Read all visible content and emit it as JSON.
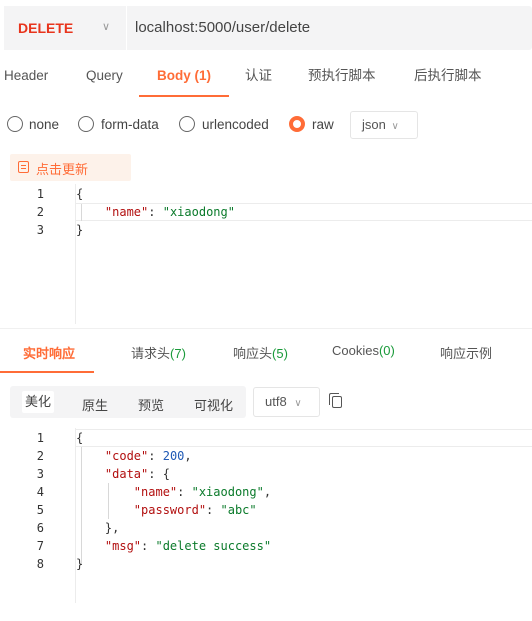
{
  "request": {
    "method": "DELETE",
    "url": "localhost:5000/user/delete"
  },
  "tabs": [
    {
      "label": "Header"
    },
    {
      "label": "Query"
    },
    {
      "label": "Body (1)"
    },
    {
      "label": "认证"
    },
    {
      "label": "预执行脚本"
    },
    {
      "label": "后执行脚本"
    }
  ],
  "body_types": {
    "options": [
      "none",
      "form-data",
      "urlencoded",
      "raw"
    ],
    "selected": "raw",
    "format": "json"
  },
  "beautify_label": "点击更新",
  "request_body": {
    "line_numbers": [
      "1",
      "2",
      "3"
    ],
    "lines": [
      "{",
      "    \"name\": \"xiaodong\"",
      "}"
    ]
  },
  "response_tabs": [
    {
      "label": "实时响应",
      "count": ""
    },
    {
      "label": "请求头",
      "count": "(7)"
    },
    {
      "label": "响应头",
      "count": "(5)"
    },
    {
      "label": "Cookies",
      "count": "(0)"
    },
    {
      "label": "响应示例",
      "count": ""
    }
  ],
  "view_modes": [
    "美化",
    "原生",
    "预览",
    "可视化"
  ],
  "encoding": "utf8",
  "response_body": {
    "line_numbers": [
      "1",
      "2",
      "3",
      "4",
      "5",
      "6",
      "7",
      "8"
    ],
    "lines": [
      "{",
      "    \"code\": 200,",
      "    \"data\": {",
      "        \"name\": \"xiaodong\",",
      "        \"password\": \"abc\"",
      "    },",
      "    \"msg\": \"delete success\"",
      "}"
    ]
  },
  "colors": {
    "accent": "#ff6c37",
    "method": "#e8341c",
    "json_key": "#b20f0f",
    "json_string": "#0a7a2a",
    "json_number": "#1f59b5",
    "count": "#1a9a3a"
  }
}
